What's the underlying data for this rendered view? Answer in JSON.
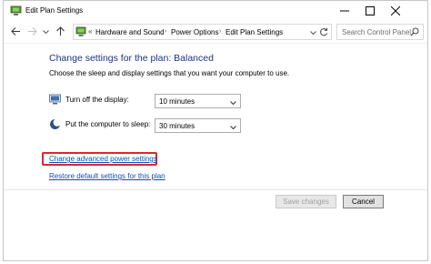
{
  "window": {
    "title": "Edit Plan Settings",
    "controls": {
      "minimize": "minimize-icon",
      "maximize": "maximize-icon",
      "close": "close-icon"
    }
  },
  "address_bar": {
    "lead": "«",
    "crumbs": [
      "Hardware and Sound",
      "Power Options",
      "Edit Plan Settings"
    ],
    "search_placeholder": "Search Control Panel"
  },
  "content": {
    "heading": "Change settings for the plan: Balanced",
    "subtext": "Choose the sleep and display settings that you want your computer to use.",
    "settings": [
      {
        "label": "Turn off the display:",
        "value": "10 minutes",
        "icon": "monitor-icon"
      },
      {
        "label": "Put the computer to sleep:",
        "value": "30 minutes",
        "icon": "moon-icon"
      }
    ],
    "links": {
      "advanced": "Change advanced power settings",
      "restore": "Restore default settings for this plan"
    }
  },
  "footer": {
    "save_label": "Save changes",
    "cancel_label": "Cancel"
  },
  "colors": {
    "heading": "#1e3287",
    "link": "#0b4fbd",
    "highlight": "#e4222e"
  }
}
